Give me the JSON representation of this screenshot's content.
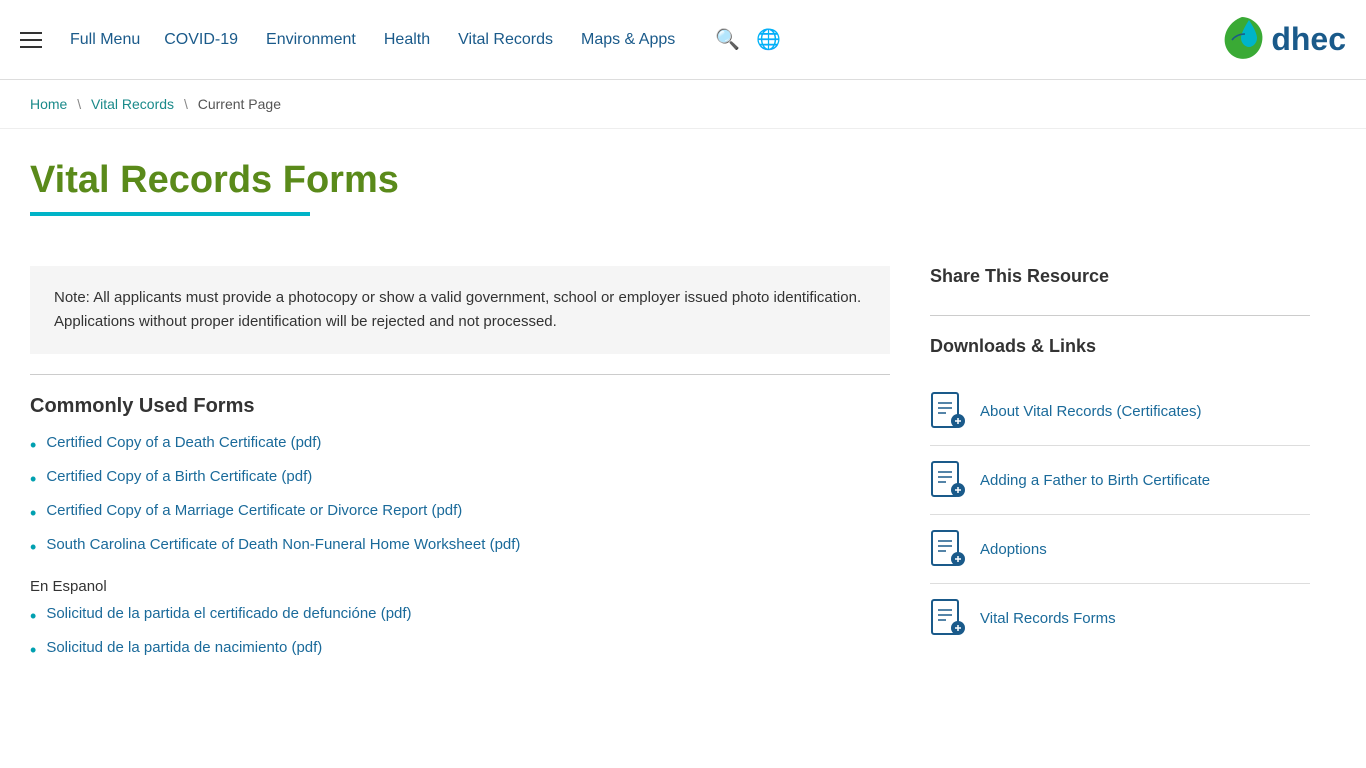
{
  "header": {
    "hamburger_label": "≡",
    "full_menu_label": "Full Menu",
    "nav_items": [
      {
        "label": "COVID-19",
        "href": "#"
      },
      {
        "label": "Environment",
        "href": "#"
      },
      {
        "label": "Health",
        "href": "#"
      },
      {
        "label": "Vital Records",
        "href": "#"
      },
      {
        "label": "Maps & Apps",
        "href": "#"
      }
    ],
    "search_icon": "🔍",
    "globe_icon": "🌐",
    "logo_text": "dhec"
  },
  "breadcrumb": {
    "home": "Home",
    "vital_records": "Vital Records",
    "current": "Current Page"
  },
  "page": {
    "title": "Vital Records Forms",
    "note": "Note: All applicants must provide a photocopy or show a valid government, school or employer issued photo identification. Applications without proper identification will be rejected and not processed.",
    "commonly_used_heading": "Commonly Used Forms",
    "forms": [
      {
        "label": "Certified Copy of a Death Certificate (pdf)",
        "href": "#"
      },
      {
        "label": "Certified Copy of a Birth Certificate (pdf)",
        "href": "#"
      },
      {
        "label": "Certified Copy of a Marriage Certificate or Divorce Report (pdf)",
        "href": "#"
      },
      {
        "label": "South Carolina Certificate of Death Non-Funeral Home Worksheet (pdf)",
        "href": "#"
      }
    ],
    "espanol_label": "En Espanol",
    "espanol_forms": [
      {
        "label": "Solicitud de la partida el certificado de defuncióne (pdf)",
        "href": "#"
      },
      {
        "label": "Solicitud de la partida de nacimiento (pdf)",
        "href": "#"
      }
    ]
  },
  "sidebar": {
    "share_title": "Share This Resource",
    "downloads_title": "Downloads & Links",
    "download_items": [
      {
        "label": "About Vital Records (Certificates)",
        "href": "#"
      },
      {
        "label": "Adding a Father to Birth Certificate",
        "href": "#"
      },
      {
        "label": "Adoptions",
        "href": "#"
      },
      {
        "label": "Vital Records Forms",
        "href": "#"
      }
    ]
  }
}
